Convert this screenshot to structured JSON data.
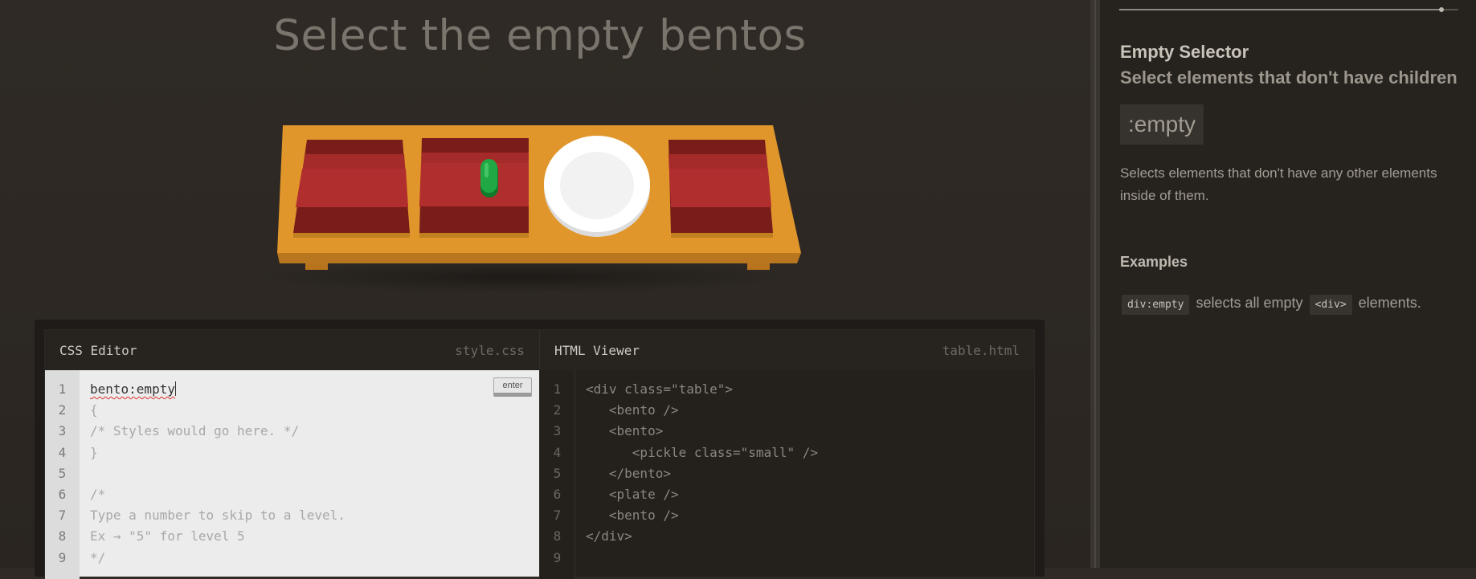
{
  "level": {
    "title": "Select the empty bentos"
  },
  "table": {
    "items": [
      "bento",
      "bento-with-pickle",
      "plate",
      "bento"
    ]
  },
  "css_editor": {
    "title": "CSS Editor",
    "filename": "style.css",
    "input_value": "bento:empty",
    "enter_label": "enter",
    "line_numbers": [
      "1",
      "2",
      "3",
      "4",
      "5",
      "6",
      "7",
      "8",
      "9"
    ],
    "static_code": "{\n/* Styles would go here. */\n}\n\n/*\nType a number to skip to a level.\nEx → \"5\" for level 5\n*/"
  },
  "html_viewer": {
    "title": "HTML Viewer",
    "filename": "table.html",
    "line_numbers": [
      "1",
      "2",
      "3",
      "4",
      "5",
      "6",
      "7",
      "8",
      "9"
    ],
    "code": "<div class=\"table\">\n   <bento />\n   <bento>\n      <pickle class=\"small\" />\n   </bento>\n   <plate />\n   <bento />\n</div>"
  },
  "sidebar": {
    "progress": 0.95,
    "selector_name": "Empty Selector",
    "title": "Select elements that don't have children",
    "syntax": ":empty",
    "hint": "Selects elements that don't have any other elements inside of them.",
    "examples_title": "Examples",
    "example": {
      "code1": "div:empty",
      "text1": "selects all empty",
      "code2": "<div>",
      "text2": "elements."
    }
  },
  "colors": {
    "table_wood": "#e0962b",
    "bento": "#a52a2a",
    "pickle": "#1a9a3a",
    "plate": "#ffffff"
  }
}
